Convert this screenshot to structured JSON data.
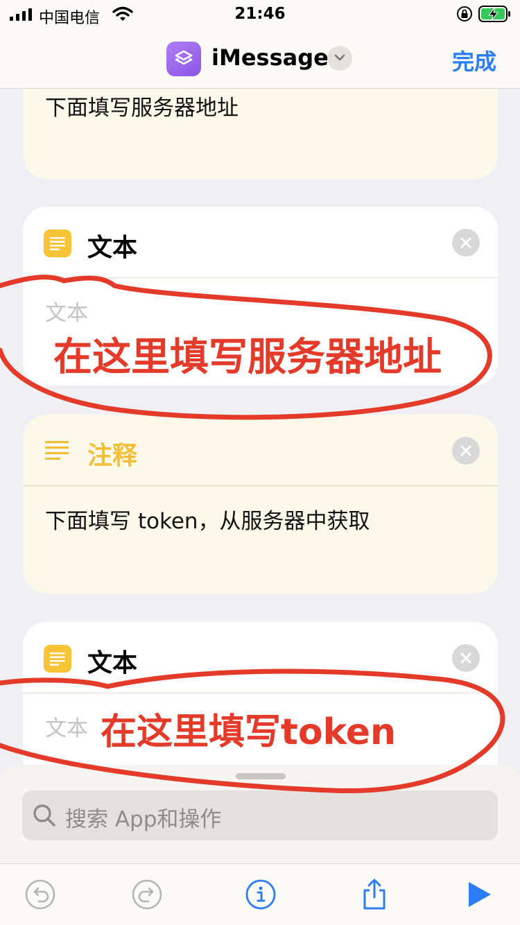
{
  "status_bar": {
    "carrier": "中国电信",
    "time": "21:46"
  },
  "nav": {
    "title": "iMessage",
    "done": "完成"
  },
  "cards": {
    "comment1": {
      "text": "下面填写服务器地址"
    },
    "text1": {
      "title": "文本",
      "placeholder": "文本"
    },
    "comment2": {
      "title": "注释",
      "text": "下面填写 token，从服务器中获取"
    },
    "text2": {
      "title": "文本",
      "placeholder": "文本"
    }
  },
  "annotations": {
    "server": "在这里填写服务器地址",
    "token": "在这里填写token",
    "color": "#e43a2a"
  },
  "search": {
    "placeholder": "搜索 App和操作"
  },
  "toolbar": {
    "undo": "undo-icon",
    "redo": "redo-icon",
    "info": "info-icon",
    "share": "share-icon",
    "run": "play-icon"
  },
  "colors": {
    "accent": "#2b7cf5",
    "comment_bg": "#fcf9ea",
    "comment_title": "#f2be35",
    "text_icon": "#f6c436",
    "shortcut_icon": "#9b68ee"
  }
}
